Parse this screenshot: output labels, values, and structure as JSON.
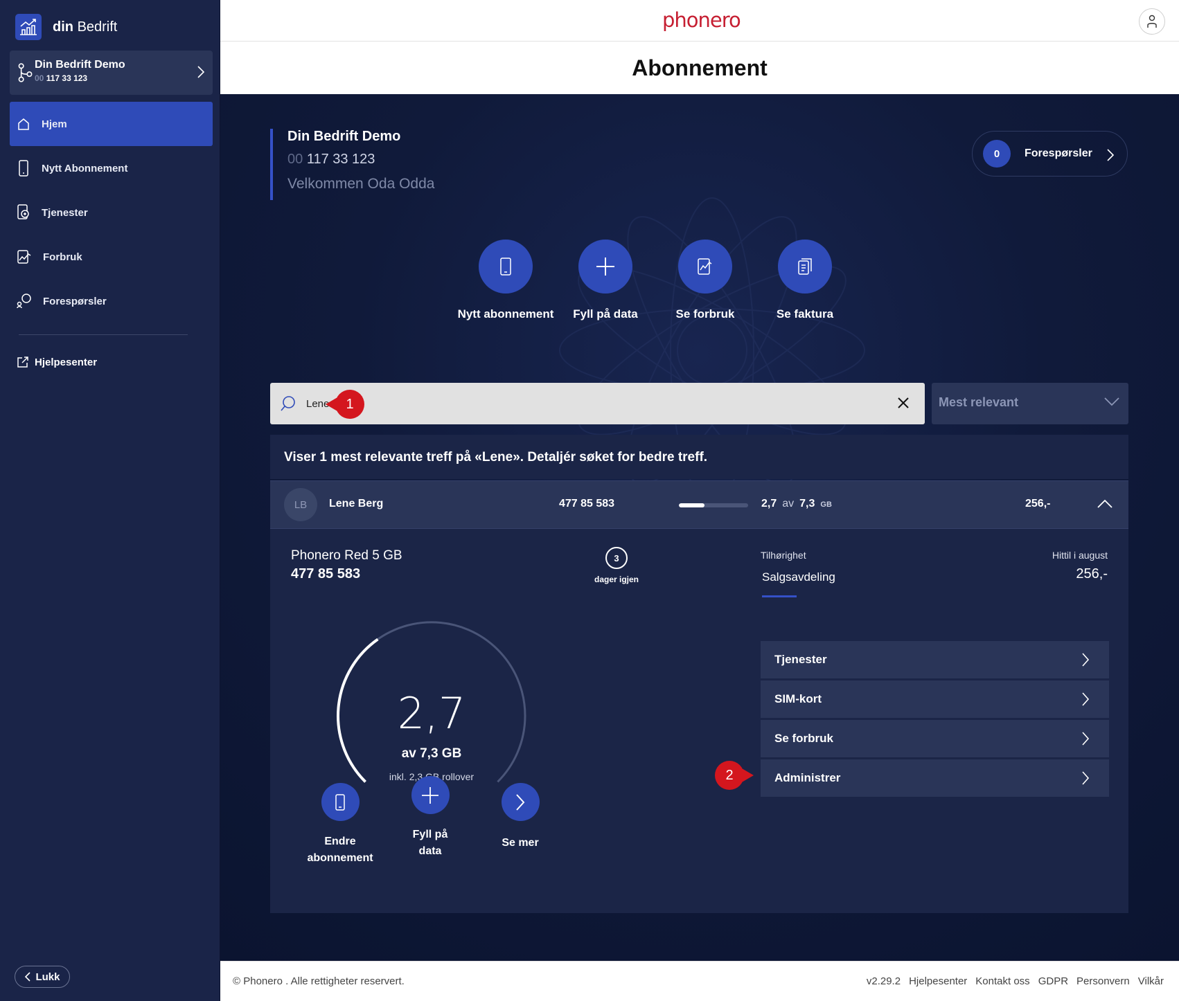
{
  "sidebar": {
    "brand_prefix": "din",
    "brand_name": "Bedrift",
    "company": {
      "name": "Din Bedrift Demo",
      "num_prefix": "00",
      "num": "117 33 123"
    },
    "items": [
      {
        "label": "Hjem",
        "icon": "home-icon",
        "active": true
      },
      {
        "label": "Nytt Abonnement",
        "icon": "phone-icon"
      },
      {
        "label": "Tjenester",
        "icon": "services-icon"
      },
      {
        "label": "Forbruk",
        "icon": "chart-icon"
      },
      {
        "label": "Forespørsler",
        "icon": "chat-icon"
      }
    ],
    "help_label": "Hjelpesenter",
    "close_label": "Lukk"
  },
  "header": {
    "logo": "phonero",
    "title": "Abonnement"
  },
  "welcome": {
    "name": "Din Bedrift Demo",
    "num_prefix": "00",
    "num": "117 33 123",
    "greeting": "Velkommen Oda Odda"
  },
  "requests": {
    "count": "0",
    "label": "Forespørsler"
  },
  "quick_actions": [
    {
      "label": "Nytt abonnement",
      "icon": "phone-icon"
    },
    {
      "label": "Fyll på data",
      "icon": "plus-icon"
    },
    {
      "label": "Se forbruk",
      "icon": "chart-icon"
    },
    {
      "label": "Se faktura",
      "icon": "invoice-icon"
    }
  ],
  "search": {
    "value": "Lene",
    "sort": "Mest relevant"
  },
  "results_text": "Viser 1 mest relevante treff på «Lene». Detaljér søket for bedre treff.",
  "subscription": {
    "initials": "LB",
    "name": "Lene Berg",
    "number": "477 85 583",
    "used": "2,7",
    "of": "av",
    "total": "7,3",
    "unit": "GB",
    "usage_fraction": 0.37,
    "price": "256,-",
    "plan": "Phonero Red 5 GB",
    "days_left": "3",
    "days_label": "dager igjen",
    "affiliation_label": "Tilhørighet",
    "affiliation": "Salgsavdeling",
    "month_label": "Hittil i august",
    "month_total": "256,-",
    "gauge_value": "2,7",
    "gauge_sub": "av 7,3 GB",
    "rollover": "inkl. 2,3 GB rollover",
    "actions": {
      "change": "Endre abonnement",
      "topup": "Fyll på data",
      "more": "Se mer"
    },
    "menu": [
      "Tjenester",
      "SIM-kort",
      "Se forbruk",
      "Administrer"
    ]
  },
  "markers": [
    "1",
    "2"
  ],
  "footer": {
    "copyright": "© Phonero . Alle rettigheter reservert.",
    "version": "v2.29.2",
    "links": [
      "Hjelpesenter",
      "Kontakt oss",
      "GDPR",
      "Personvern",
      "Vilkår"
    ]
  },
  "colors": {
    "sidebar": "#1a2448",
    "accent": "#2f4bb8",
    "brand_red": "#c61f32",
    "marker": "#d4161e"
  }
}
